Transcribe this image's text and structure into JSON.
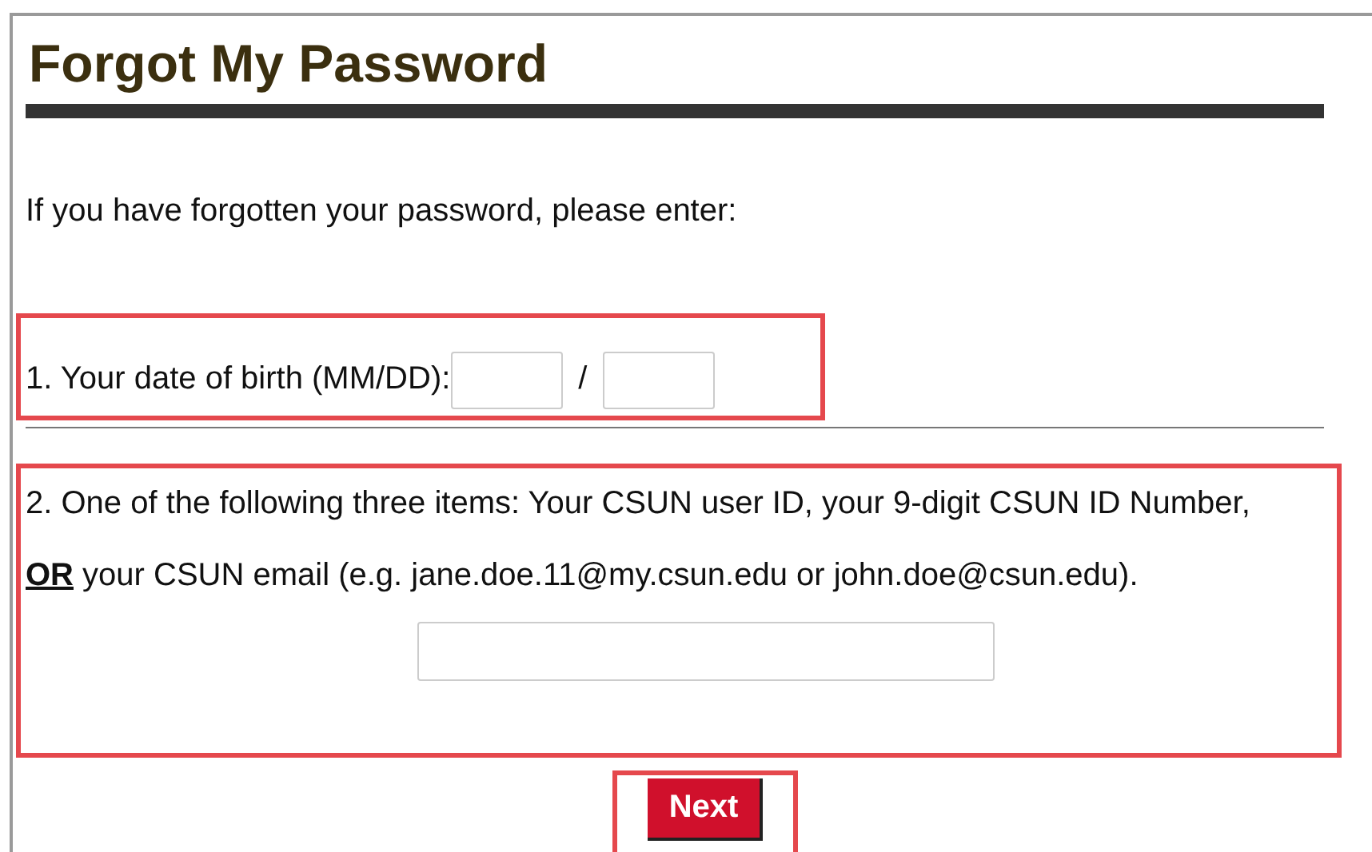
{
  "heading": "Forgot My Password",
  "intro": "If you have forgotten your password, please enter:",
  "birth_date": {
    "label": "1. Your date of birth (MM/DD):",
    "separator": "/",
    "highlighted": true
  },
  "identifier": {
    "text": "2. One of the following three items: Your CSUN user ID, your 9-digit CSUN ID Number, **OR** your CSUN email (e.g. jane.doe.11@my.csun.edu or john.doe@csun.edu).",
    "highlighted": true
  },
  "next_button": {
    "label": "Next",
    "highlighted": true
  }
}
